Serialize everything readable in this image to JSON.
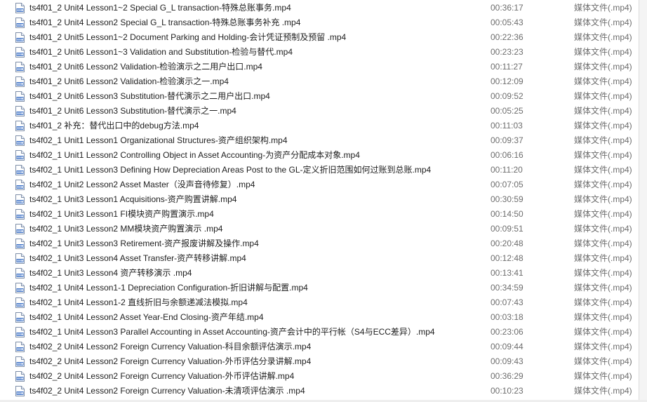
{
  "files": [
    {
      "name": "ts4f01_2 Unit4 Lesson1~2 Special G_L transaction-特殊总账事务.mp4",
      "duration": "00:36:17",
      "type": "媒体文件(.mp4)",
      "icon": "video-file-icon"
    },
    {
      "name": "ts4f01_2 Unit4 Lesson2 Special G_L transaction-特殊总账事务补充 .mp4",
      "duration": "00:05:43",
      "type": "媒体文件(.mp4)",
      "icon": "video-file-icon"
    },
    {
      "name": "ts4f01_2 Unit5 Lesson1~2 Document Parking and Holding-会计凭证预制及预留 .mp4",
      "duration": "00:22:36",
      "type": "媒体文件(.mp4)",
      "icon": "video-file-icon"
    },
    {
      "name": "ts4f01_2 Unit6 Lesson1~3 Validation and Substitution-检验与替代.mp4",
      "duration": "00:23:23",
      "type": "媒体文件(.mp4)",
      "icon": "video-file-icon"
    },
    {
      "name": "ts4f01_2 Unit6 Lesson2 Validation-检验演示之二用户出口.mp4",
      "duration": "00:11:27",
      "type": "媒体文件(.mp4)",
      "icon": "video-file-icon"
    },
    {
      "name": "ts4f01_2 Unit6 Lesson2 Validation-检验演示之一.mp4",
      "duration": "00:12:09",
      "type": "媒体文件(.mp4)",
      "icon": "video-file-icon"
    },
    {
      "name": "ts4f01_2 Unit6 Lesson3 Substitution-替代演示之二用户出口.mp4",
      "duration": "00:09:52",
      "type": "媒体文件(.mp4)",
      "icon": "video-file-icon"
    },
    {
      "name": "ts4f01_2 Unit6 Lesson3 Substitution-替代演示之一.mp4",
      "duration": "00:05:25",
      "type": "媒体文件(.mp4)",
      "icon": "video-file-icon"
    },
    {
      "name": "ts4f01_2 补充：替代出口中的debug方法.mp4",
      "duration": "00:11:03",
      "type": "媒体文件(.mp4)",
      "icon": "video-file-icon"
    },
    {
      "name": "ts4f02_1 Unit1 Lesson1 Organizational Structures-资产组织架构.mp4",
      "duration": "00:09:37",
      "type": "媒体文件(.mp4)",
      "icon": "video-file-icon"
    },
    {
      "name": "ts4f02_1 Unit1 Lesson2 Controlling Object in Asset Accounting-为资产分配成本对象.mp4",
      "duration": "00:06:16",
      "type": "媒体文件(.mp4)",
      "icon": "video-file-icon"
    },
    {
      "name": "ts4f02_1 Unit1 Lesson3 Defining How Depreciation Areas Post to the GL-定义折旧范围如何过账到总账.mp4",
      "duration": "00:11:20",
      "type": "媒体文件(.mp4)",
      "icon": "video-file-icon"
    },
    {
      "name": "ts4f02_1 Unit2 Lesson2 Asset Master（没声音待修复）.mp4",
      "duration": "00:07:05",
      "type": "媒体文件(.mp4)",
      "icon": "video-file-icon"
    },
    {
      "name": "ts4f02_1 Unit3 Lesson1 Acquisitions-资产购置讲解.mp4",
      "duration": "00:30:59",
      "type": "媒体文件(.mp4)",
      "icon": "video-file-icon"
    },
    {
      "name": "ts4f02_1 Unit3 Lesson1 FI模块资产购置演示.mp4",
      "duration": "00:14:50",
      "type": "媒体文件(.mp4)",
      "icon": "video-file-icon"
    },
    {
      "name": "ts4f02_1 Unit3 Lesson2 MM模块资产购置演示 .mp4",
      "duration": "00:09:51",
      "type": "媒体文件(.mp4)",
      "icon": "video-file-icon"
    },
    {
      "name": "ts4f02_1 Unit3 Lesson3 Retirement-资产报废讲解及操作.mp4",
      "duration": "00:20:48",
      "type": "媒体文件(.mp4)",
      "icon": "video-file-icon"
    },
    {
      "name": "ts4f02_1 Unit3 Lesson4 Asset Transfer-资产转移讲解.mp4",
      "duration": "00:12:48",
      "type": "媒体文件(.mp4)",
      "icon": "video-file-icon"
    },
    {
      "name": "ts4f02_1 Unit3 Lesson4 资产转移演示 .mp4",
      "duration": "00:13:41",
      "type": "媒体文件(.mp4)",
      "icon": "video-file-icon"
    },
    {
      "name": "ts4f02_1 Unit4 Lesson1-1 Depreciation Configuration-折旧讲解与配置.mp4",
      "duration": "00:34:59",
      "type": "媒体文件(.mp4)",
      "icon": "video-file-icon"
    },
    {
      "name": "ts4f02_1 Unit4 Lesson1-2 直线折旧与余额递减法模拟.mp4",
      "duration": "00:07:43",
      "type": "媒体文件(.mp4)",
      "icon": "video-file-icon"
    },
    {
      "name": "ts4f02_1 Unit4 Lesson2 Asset Year-End Closing-资产年结.mp4",
      "duration": "00:03:18",
      "type": "媒体文件(.mp4)",
      "icon": "video-file-icon"
    },
    {
      "name": "ts4f02_1 Unit4 Lesson3 Parallel Accounting in Asset Accounting-资产会计中的平行帐（S4与ECC差异）.mp4",
      "duration": "00:23:06",
      "type": "媒体文件(.mp4)",
      "icon": "video-file-icon"
    },
    {
      "name": "ts4f02_2 Unit4 Lesson2 Foreign Currency Valuation-科目余额评估演示.mp4",
      "duration": "00:09:44",
      "type": "媒体文件(.mp4)",
      "icon": "video-file-icon"
    },
    {
      "name": "ts4f02_2 Unit4 Lesson2 Foreign Currency Valuation-外币评估分录讲解.mp4",
      "duration": "00:09:43",
      "type": "媒体文件(.mp4)",
      "icon": "video-file-icon"
    },
    {
      "name": "ts4f02_2 Unit4 Lesson2 Foreign Currency Valuation-外币评估讲解.mp4",
      "duration": "00:36:29",
      "type": "媒体文件(.mp4)",
      "icon": "video-file-icon"
    },
    {
      "name": "ts4f02_2 Unit4 Lesson2 Foreign Currency Valuation-未清项评估演示 .mp4",
      "duration": "00:10:23",
      "type": "媒体文件(.mp4)",
      "icon": "video-file-icon"
    }
  ]
}
